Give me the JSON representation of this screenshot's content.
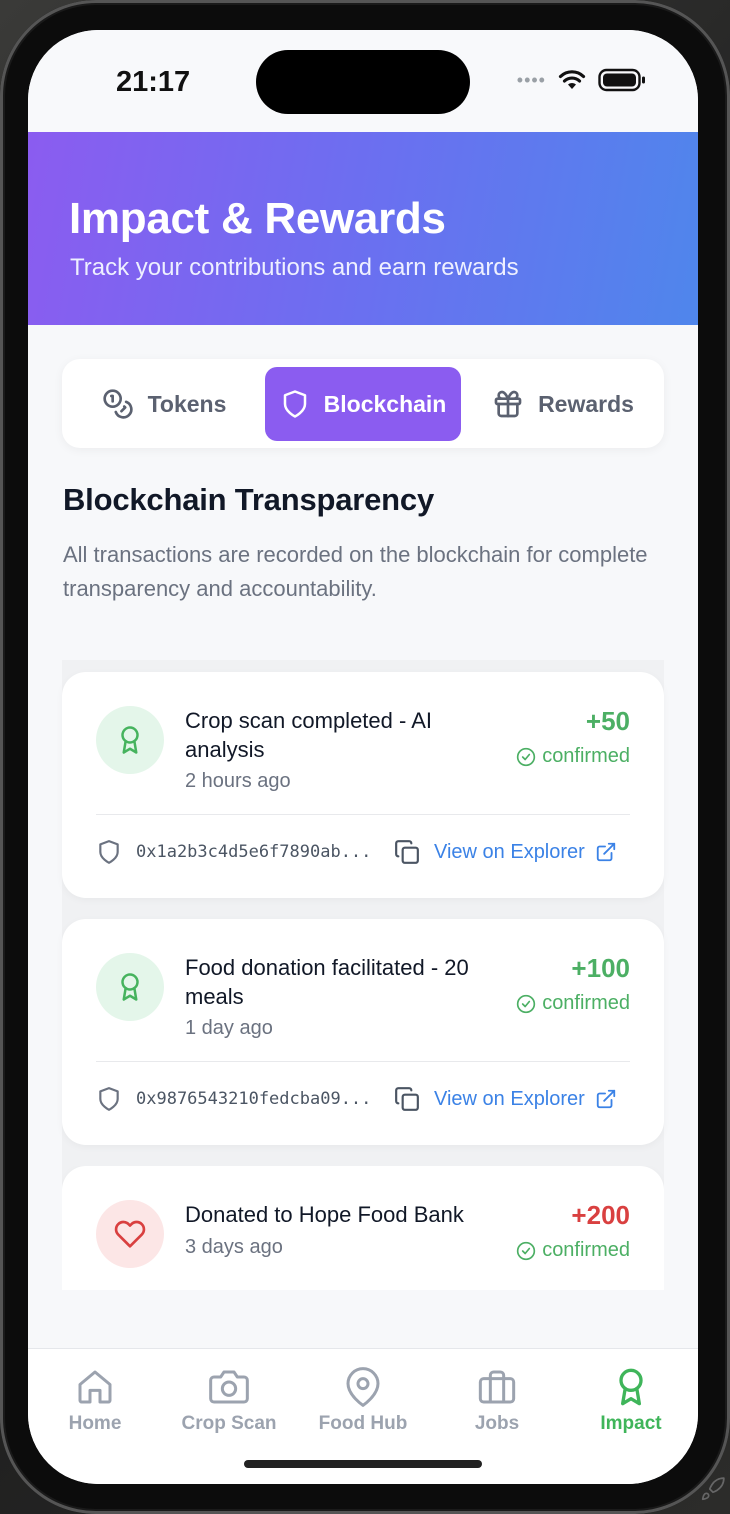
{
  "status_bar": {
    "time": "21:17"
  },
  "header": {
    "title": "Impact & Rewards",
    "subtitle": "Track your contributions and earn rewards"
  },
  "tabs": [
    {
      "label": "Tokens",
      "icon": "coins-icon",
      "active": false
    },
    {
      "label": "Blockchain",
      "icon": "shield-icon",
      "active": true
    },
    {
      "label": "Rewards",
      "icon": "gift-icon",
      "active": false
    }
  ],
  "section": {
    "title": "Blockchain Transparency",
    "description": "All transactions are recorded on the blockchain for complete transparency and accountability."
  },
  "transactions": [
    {
      "icon": "award-icon",
      "title": "Crop scan completed - AI analysis",
      "time": "2 hours ago",
      "amount": "+50",
      "status": "confirmed",
      "hash": "0x1a2b3c4d5e6f7890ab...",
      "explorer_label": "View on Explorer",
      "amount_color": "#4caf64"
    },
    {
      "icon": "award-icon",
      "title": "Food donation facilitated - 20 meals",
      "time": "1 day ago",
      "amount": "+100",
      "status": "confirmed",
      "hash": "0x9876543210fedcba09...",
      "explorer_label": "View on Explorer",
      "amount_color": "#4caf64"
    },
    {
      "icon": "heart-icon",
      "title": "Donated to Hope Food Bank",
      "time": "3 days ago",
      "amount": "+200",
      "status": "confirmed",
      "amount_color": "#d94040"
    }
  ],
  "bottom_nav": [
    {
      "label": "Home",
      "icon": "home-icon",
      "active": false
    },
    {
      "label": "Crop Scan",
      "icon": "camera-icon",
      "active": false
    },
    {
      "label": "Food Hub",
      "icon": "map-pin-icon",
      "active": false
    },
    {
      "label": "Jobs",
      "icon": "briefcase-icon",
      "active": false
    },
    {
      "label": "Impact",
      "icon": "award-icon",
      "active": true
    }
  ],
  "colors": {
    "accent_purple": "#8b5cf0",
    "header_gradient_end": "#4f86ec",
    "confirmed_green": "#4caf64",
    "link_blue": "#3b82e6",
    "nav_active": "#3fb55a"
  }
}
